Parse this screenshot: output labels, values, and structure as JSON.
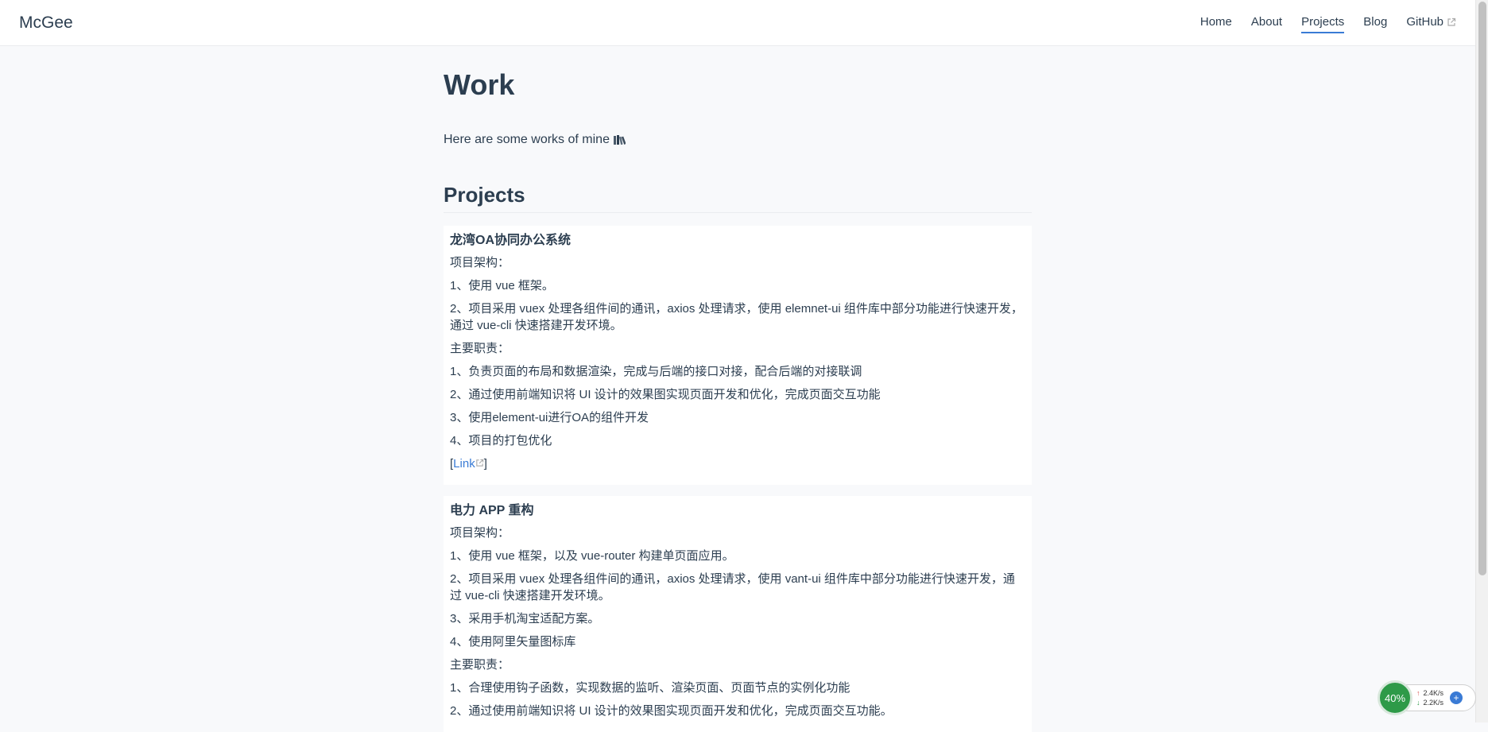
{
  "nav": {
    "brand": "McGee",
    "links": [
      {
        "label": "Home"
      },
      {
        "label": "About"
      },
      {
        "label": "Projects"
      },
      {
        "label": "Blog"
      },
      {
        "label": "GitHub"
      }
    ]
  },
  "page": {
    "title": "Work",
    "intro": "Here are some works of mine",
    "intro_icon": "books-icon",
    "section_title": "Projects"
  },
  "projects": [
    {
      "title": "龙湾OA协同办公系统",
      "lines": [
        "项目架构：",
        "1、使用 vue 框架。",
        "2、项目采用 vuex 处理各组件间的通讯，axios 处理请求，使用 elemnet-ui 组件库中部分功能进行快速开发，通过 vue-cli 快速搭建开发环境。",
        "主要职责：",
        "1、负责页面的布局和数据渲染，完成与后端的接口对接，配合后端的对接联调",
        "2、通过使用前端知识将 UI 设计的效果图实现页面开发和优化，完成页面交互功能",
        "3、使用element-ui进行OA的组件开发",
        "4、项目的打包优化"
      ],
      "link_label": "Link"
    },
    {
      "title": "电力 APP 重构",
      "lines": [
        "项目架构：",
        "1、使用 vue 框架，以及 vue-router 构建单页面应用。",
        "2、项目采用 vuex 处理各组件间的通讯，axios 处理请求，使用 vant-ui 组件库中部分功能进行快速开发，通过 vue-cli 快速搭建开发环境。",
        "3、采用手机淘宝适配方案。",
        "4、使用阿里矢量图标库",
        "主要职责：",
        "1、合理使用钩子函数，实现数据的监听、渲染页面、页面节点的实例化功能",
        "2、通过使用前端知识将 UI 设计的效果图实现页面开发和优化，完成页面交互功能。"
      ]
    }
  ],
  "net_widget": {
    "percent": "40%",
    "up_rate": "2.4K/s",
    "down_rate": "2.2K/s",
    "plus": "+"
  },
  "colors": {
    "accent": "#3a7bd5",
    "text": "#2c3e50",
    "background": "#f8f9fb",
    "widget_green": "#2e9a48"
  }
}
